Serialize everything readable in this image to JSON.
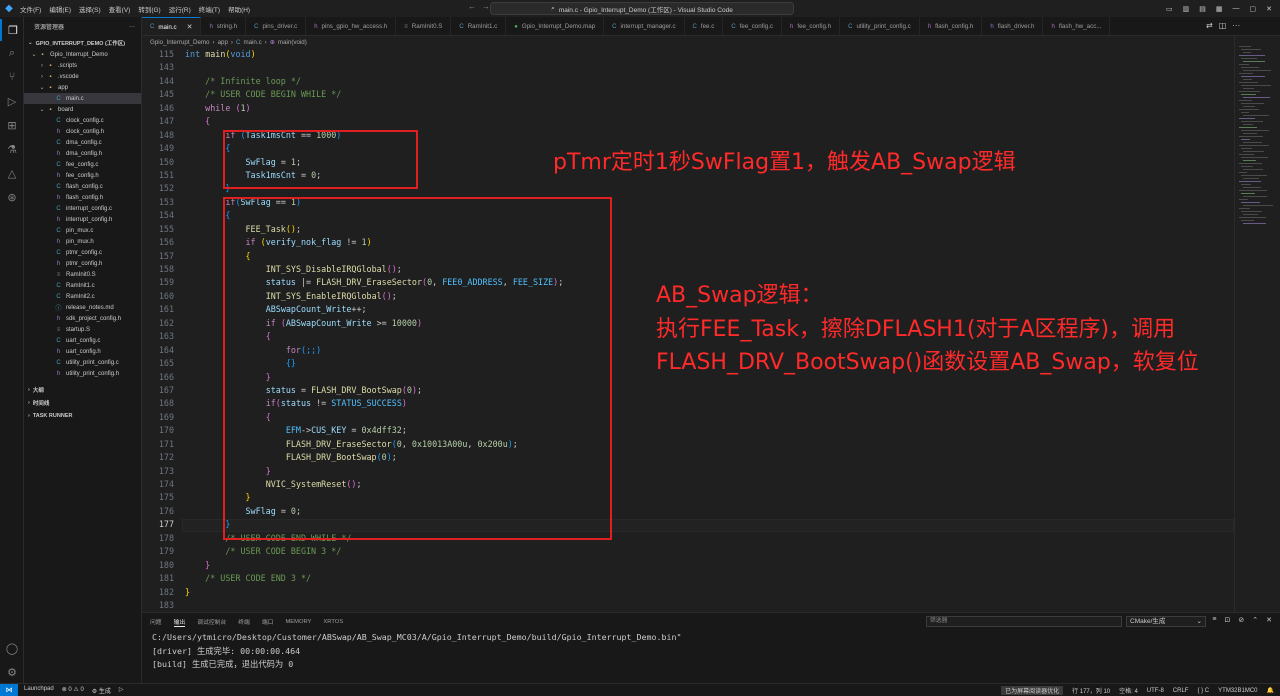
{
  "window": {
    "title": "main.c - Gpio_Interrupt_Demo (工作区) - Visual Studio Code",
    "menu": [
      "文件(F)",
      "编辑(E)",
      "选择(S)",
      "查看(V)",
      "转到(G)",
      "运行(R)",
      "终端(T)",
      "帮助(H)"
    ]
  },
  "sidebar": {
    "title": "资源管理器",
    "workspace": "GPIO_INTERRUPT_DEMO (工作区)",
    "tree": [
      {
        "label": "Gpio_Interrupt_Demo",
        "kind": "folder",
        "depth": 1,
        "twisty": "⌄"
      },
      {
        "label": ".scripts",
        "kind": "folder",
        "depth": 2,
        "twisty": "›"
      },
      {
        "label": ".vscode",
        "kind": "folder",
        "depth": 2,
        "twisty": "›"
      },
      {
        "label": "app",
        "kind": "folder",
        "depth": 2,
        "twisty": "⌄"
      },
      {
        "label": "main.c",
        "kind": "c",
        "depth": 3,
        "twisty": "",
        "selected": true
      },
      {
        "label": "board",
        "kind": "folder",
        "depth": 2,
        "twisty": "⌄"
      },
      {
        "label": "clock_config.c",
        "kind": "c",
        "depth": 3,
        "twisty": ""
      },
      {
        "label": "clock_config.h",
        "kind": "h",
        "depth": 3,
        "twisty": ""
      },
      {
        "label": "dma_config.c",
        "kind": "c",
        "depth": 3,
        "twisty": ""
      },
      {
        "label": "dma_config.h",
        "kind": "h",
        "depth": 3,
        "twisty": ""
      },
      {
        "label": "fee_config.c",
        "kind": "c",
        "depth": 3,
        "twisty": ""
      },
      {
        "label": "fee_config.h",
        "kind": "h",
        "depth": 3,
        "twisty": ""
      },
      {
        "label": "flash_config.c",
        "kind": "c",
        "depth": 3,
        "twisty": ""
      },
      {
        "label": "flash_config.h",
        "kind": "h",
        "depth": 3,
        "twisty": ""
      },
      {
        "label": "interrupt_config.c",
        "kind": "c",
        "depth": 3,
        "twisty": ""
      },
      {
        "label": "interrupt_config.h",
        "kind": "h",
        "depth": 3,
        "twisty": ""
      },
      {
        "label": "pin_mux.c",
        "kind": "c",
        "depth": 3,
        "twisty": ""
      },
      {
        "label": "pin_mux.h",
        "kind": "h",
        "depth": 3,
        "twisty": ""
      },
      {
        "label": "ptmr_config.c",
        "kind": "c",
        "depth": 3,
        "twisty": ""
      },
      {
        "label": "ptmr_config.h",
        "kind": "h",
        "depth": 3,
        "twisty": ""
      },
      {
        "label": "RamInit0.S",
        "kind": "s",
        "depth": 3,
        "twisty": ""
      },
      {
        "label": "RamInit1.c",
        "kind": "c",
        "depth": 3,
        "twisty": ""
      },
      {
        "label": "RamInit2.c",
        "kind": "c",
        "depth": 3,
        "twisty": ""
      },
      {
        "label": "release_notes.md",
        "kind": "md",
        "depth": 3,
        "twisty": ""
      },
      {
        "label": "sdk_project_config.h",
        "kind": "h",
        "depth": 3,
        "twisty": ""
      },
      {
        "label": "startup.S",
        "kind": "s",
        "depth": 3,
        "twisty": ""
      },
      {
        "label": "uart_config.c",
        "kind": "c",
        "depth": 3,
        "twisty": ""
      },
      {
        "label": "uart_config.h",
        "kind": "h",
        "depth": 3,
        "twisty": ""
      },
      {
        "label": "utility_print_config.c",
        "kind": "c",
        "depth": 3,
        "twisty": ""
      },
      {
        "label": "utility_print_config.h",
        "kind": "h",
        "depth": 3,
        "twisty": ""
      }
    ],
    "outline": "大纲",
    "timeline": "时间线",
    "task_runner": "TASK RUNNER"
  },
  "tabs": [
    {
      "label": "main.c",
      "kind": "c",
      "active": true
    },
    {
      "label": "string.h",
      "kind": "h"
    },
    {
      "label": "pins_driver.c",
      "kind": "c"
    },
    {
      "label": "pins_gpio_hw_access.h",
      "kind": "h"
    },
    {
      "label": "RamInit0.S",
      "kind": "s"
    },
    {
      "label": "RamInit1.c",
      "kind": "c"
    },
    {
      "label": "Gpio_Interrupt_Demo.map",
      "kind": "map"
    },
    {
      "label": "interrupt_manager.c",
      "kind": "c"
    },
    {
      "label": "fee.c",
      "kind": "c"
    },
    {
      "label": "fee_config.c",
      "kind": "c"
    },
    {
      "label": "fee_config.h",
      "kind": "h"
    },
    {
      "label": "utility_print_config.c",
      "kind": "c"
    },
    {
      "label": "flash_config.h",
      "kind": "h"
    },
    {
      "label": "flash_driver.h",
      "kind": "h"
    },
    {
      "label": "flash_hw_acc...",
      "kind": "h"
    }
  ],
  "breadcrumb": [
    "Gpio_Interrupt_Demo",
    "app",
    "main.c",
    "main(void)"
  ],
  "editor": {
    "line_numbers": [
      "115",
      "143",
      "144",
      "145",
      "146",
      "147",
      "148",
      "149",
      "150",
      "151",
      "152",
      "153",
      "154",
      "155",
      "156",
      "157",
      "158",
      "159",
      "160",
      "161",
      "162",
      "163",
      "164",
      "165",
      "166",
      "167",
      "168",
      "169",
      "170",
      "171",
      "172",
      "173",
      "174",
      "175",
      "176",
      "177",
      "178",
      "179",
      "180",
      "181",
      "182",
      "183"
    ],
    "current_line": "177"
  },
  "annotations": {
    "top": "pTmr定时1秒SwFlag置1，触发AB_Swap逻辑",
    "right_line1": "AB_Swap逻辑：",
    "right_line2": "执行FEE_Task，擦除DFLASH1(对于A区程序)，调用",
    "right_line3": "FLASH_DRV_BootSwap()函数设置AB_Swap，软复位"
  },
  "panel": {
    "tabs": [
      "问题",
      "输出",
      "调试控制台",
      "终端",
      "端口",
      "MEMORY",
      "XRTOS"
    ],
    "active_tab": "输出",
    "filter_placeholder": "筛选器",
    "channel": "CMake/生成",
    "output": [
      "C:/Users/ytmicro/Desktop/Customer/ABSwap/AB_Swap_MC03/A/Gpio_Interrupt_Demo/build/Gpio_Interrupt_Demo.bin\"",
      "[driver] 生成完毕: 00:00:00.464",
      "[build] 生成已完成，退出代码为 0"
    ]
  },
  "statusbar": {
    "left": [
      "Launchpad",
      "⊗ 0  ⚠ 0",
      "⚙ 生成",
      "▷"
    ],
    "hint": "已为屏幕阅读器优化",
    "position": "行 177，列 10",
    "spaces": "空格: 4",
    "encoding": "UTF-8",
    "eol": "CRLF",
    "language": "{ } C",
    "device": "YTM32B1MC0",
    "bell": "🔔"
  },
  "colors": {
    "accent": "#0078d4",
    "annotation": "#ff2a2a"
  }
}
